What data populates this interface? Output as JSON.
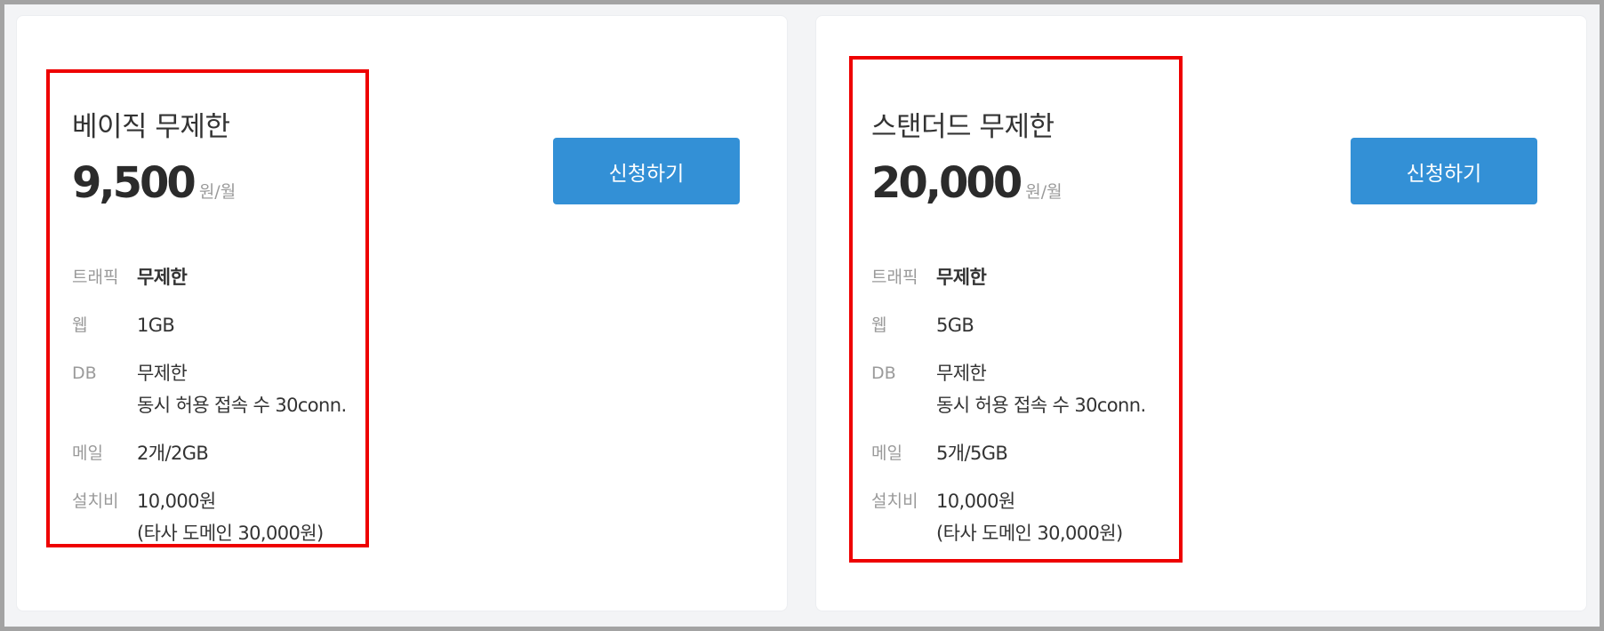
{
  "plans": [
    {
      "name": "베이직 무제한",
      "price": "9,500",
      "price_unit": "원/월",
      "apply_label": "신청하기",
      "specs": {
        "traffic": {
          "label": "트래픽",
          "value": "무제한"
        },
        "web": {
          "label": "웹",
          "value": "1GB"
        },
        "db": {
          "label": "DB",
          "value": "무제한",
          "value2": "동시 허용 접속 수 30conn."
        },
        "mail": {
          "label": "메일",
          "value": "2개/2GB"
        },
        "setup": {
          "label": "설치비",
          "value": "10,000원",
          "value2": "(타사 도메인 30,000원)"
        }
      }
    },
    {
      "name": "스탠더드 무제한",
      "price": "20,000",
      "price_unit": "원/월",
      "apply_label": "신청하기",
      "specs": {
        "traffic": {
          "label": "트래픽",
          "value": "무제한"
        },
        "web": {
          "label": "웹",
          "value": "5GB"
        },
        "db": {
          "label": "DB",
          "value": "무제한",
          "value2": "동시 허용 접속 수 30conn."
        },
        "mail": {
          "label": "메일",
          "value": "5개/5GB"
        },
        "setup": {
          "label": "설치비",
          "value": "10,000원",
          "value2": "(타사 도메인 30,000원)"
        }
      }
    }
  ],
  "colors": {
    "accent": "#3390d6",
    "highlight": "#ee0000",
    "label": "#9a9a9a",
    "text": "#333333"
  }
}
